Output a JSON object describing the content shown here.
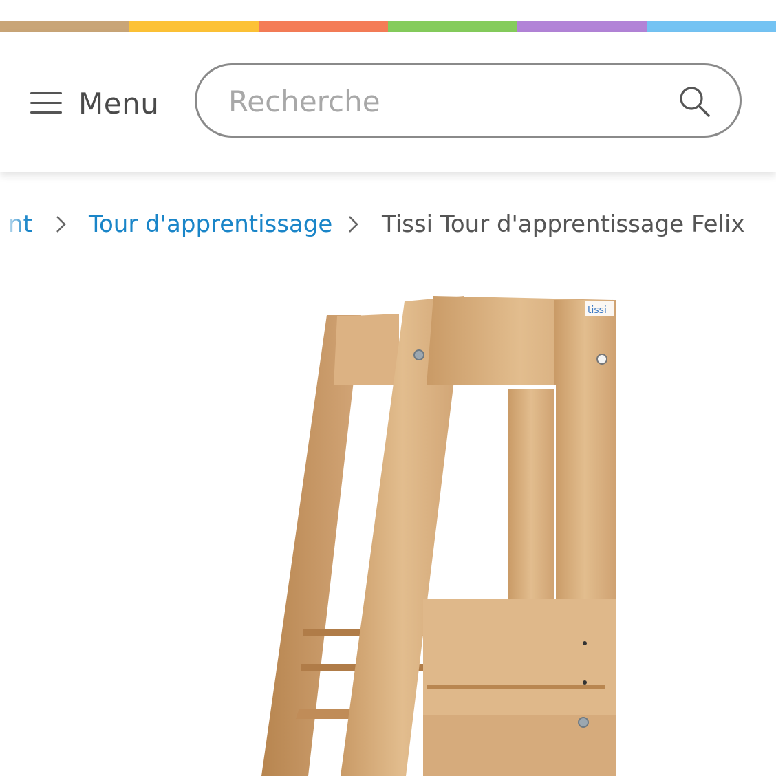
{
  "brand_colors": [
    "#c9a577",
    "#fdc236",
    "#f47c57",
    "#85cc5c",
    "#b283d7",
    "#74c3f3"
  ],
  "header": {
    "menu_label": "Menu",
    "menu_icon": "hamburger-icon",
    "search_placeholder": "Recherche",
    "search_value": "",
    "search_icon": "search-icon"
  },
  "breadcrumb": {
    "items": [
      {
        "label": "nt",
        "link": true
      },
      {
        "label": "Tour d'apprentissage",
        "link": true
      },
      {
        "label": "Tissi Tour d'apprentissage Felix",
        "link": false
      }
    ],
    "separator_icon": "chevron-right-icon",
    "link_color": "#1a85c8"
  },
  "product": {
    "logo_text": "tissi"
  }
}
